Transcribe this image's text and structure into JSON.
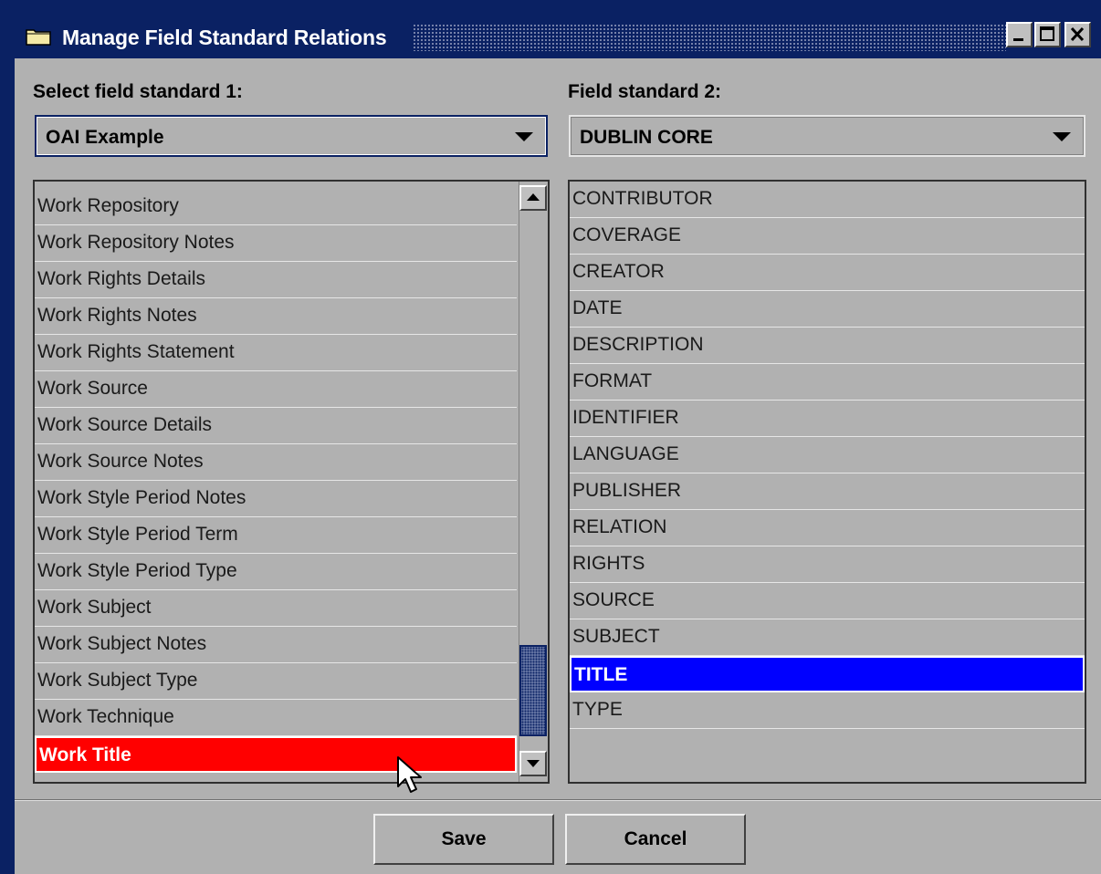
{
  "window": {
    "title": "Manage Field Standard Relations",
    "controls": [
      "minimize",
      "maximize",
      "close"
    ]
  },
  "left": {
    "label": "Select field standard 1:",
    "combo_value": "OAI Example",
    "items": [
      "Work Repository",
      "Work Repository Notes",
      "Work Rights Details",
      "Work Rights Notes",
      "Work Rights Statement",
      "Work Source",
      "Work Source Details",
      "Work Source Notes",
      "Work Style Period Notes",
      "Work Style Period Term",
      "Work Style Period Type",
      "Work Subject",
      "Work Subject Notes",
      "Work Subject Type",
      "Work Technique",
      "Work Title"
    ],
    "selected": "Work Title",
    "selected_color": "#ff0000"
  },
  "right": {
    "label": "Field standard 2:",
    "combo_value": "DUBLIN CORE",
    "items": [
      "CONTRIBUTOR",
      "COVERAGE",
      "CREATOR",
      "DATE",
      "DESCRIPTION",
      "FORMAT",
      "IDENTIFIER",
      "LANGUAGE",
      "PUBLISHER",
      "RELATION",
      "RIGHTS",
      "SOURCE",
      "SUBJECT",
      "TITLE",
      "TYPE"
    ],
    "selected": "TITLE",
    "selected_color": "#0000ff"
  },
  "buttons": {
    "save": "Save",
    "cancel": "Cancel"
  },
  "colors": {
    "titlebar": "#0a2163",
    "panel": "#b1b1b1"
  }
}
